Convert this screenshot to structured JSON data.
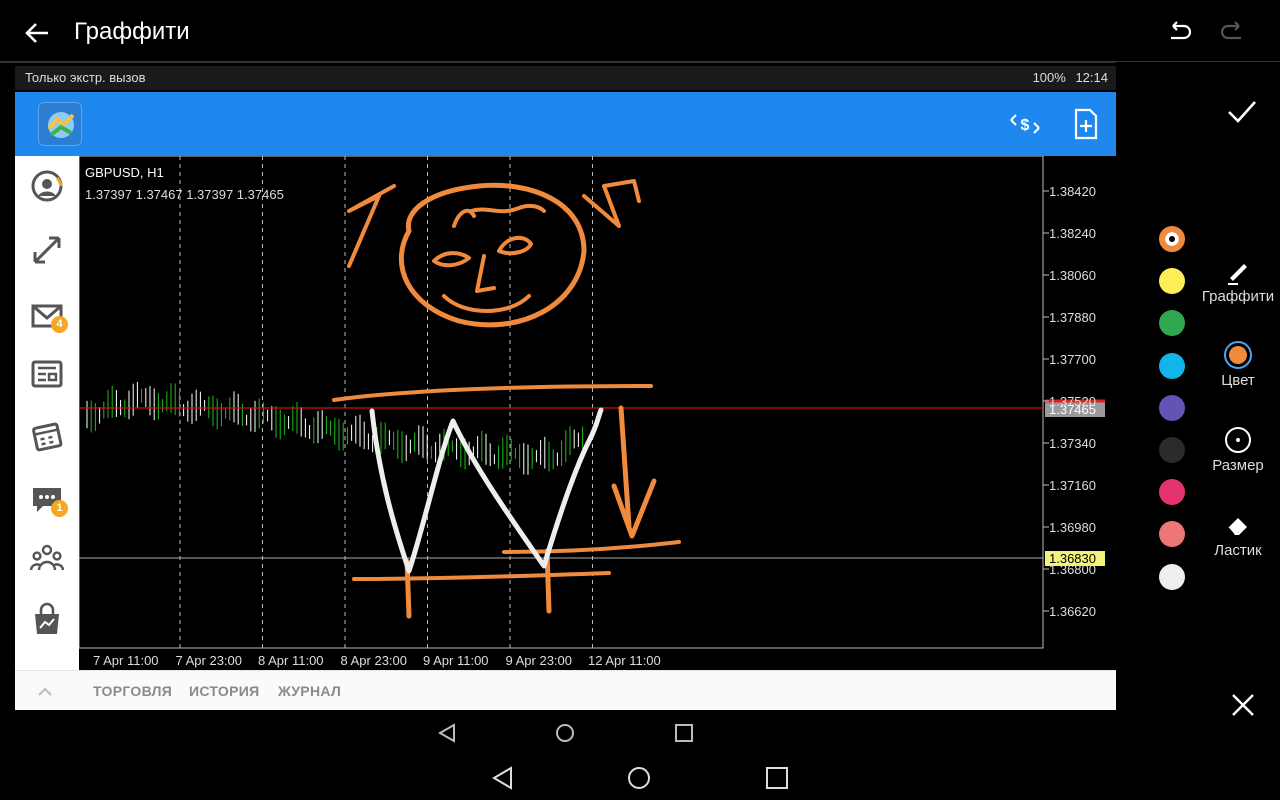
{
  "topbar": {
    "title": "Граффити"
  },
  "status": {
    "carrier": "Только экстр. вызов",
    "battery": "100%",
    "time": "12:14"
  },
  "chart": {
    "symbol": "GBPUSD, H1",
    "ohlc": "1.37397 1.37467 1.37397 1.37465",
    "price_labels": [
      "1.38420",
      "1.38240",
      "1.38060",
      "1.37880",
      "1.37700",
      "1.37520",
      "1.37340",
      "1.37160",
      "1.36980",
      "1.36800",
      "1.36620"
    ],
    "bid_label": "1.37465",
    "level_label": "1.36830",
    "time_labels": [
      "7 Apr 11:00",
      "7 Apr 23:00",
      "8 Apr 11:00",
      "8 Apr 23:00",
      "9 Apr 11:00",
      "9 Apr 23:00",
      "12 Apr 11:00"
    ]
  },
  "sidebar": {
    "mail_badge": "4",
    "chat_badge": "1"
  },
  "bottom_tabs": [
    "ТОРГОВЛЯ",
    "ИСТОРИЯ",
    "ЖУРНАЛ"
  ],
  "tools": {
    "graffiti": "Граффити",
    "color": "Цвет",
    "size": "Размер",
    "eraser": "Ластик"
  },
  "palette": [
    "#f08a3c",
    "#ffee58",
    "#2fa84f",
    "#12b5ea",
    "#6253b5",
    "#2b2b2b",
    "#e2336f",
    "#ef7676",
    "#eeeeee"
  ],
  "icons": {
    "back": "arrow-left-icon",
    "undo": "undo-icon",
    "redo": "redo-icon",
    "confirm": "checkmark-icon",
    "close": "close-icon",
    "exchange": "currency-exchange-icon",
    "new_order": "new-document-icon"
  }
}
